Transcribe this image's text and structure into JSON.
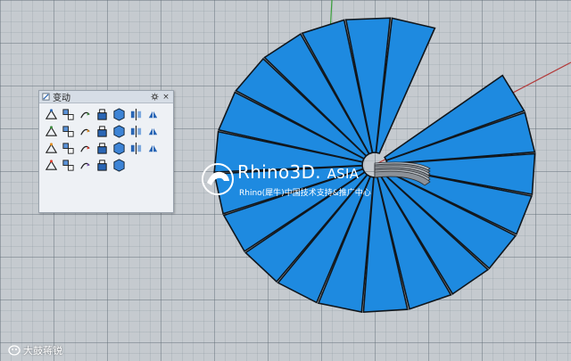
{
  "viewport": {
    "grid_color": "#5f6973",
    "background_color": "#c5cacf",
    "object_color": "#1e8ae0",
    "object_edge_color": "#10161c",
    "x_axis_color": "#b33a3a",
    "y_axis_color": "#3aa03a"
  },
  "toolbar": {
    "title": "变动",
    "settings_icon": "gear-icon",
    "close_symbol": "×",
    "tools": [
      {
        "name": "move-icon"
      },
      {
        "name": "copy-icon"
      },
      {
        "name": "rotate-icon"
      },
      {
        "name": "scale-icon"
      },
      {
        "name": "box-icon"
      },
      {
        "name": "mirror-icon"
      },
      {
        "name": "orient-icon"
      },
      {
        "name": "array-icon"
      },
      {
        "name": "twist-icon"
      },
      {
        "name": "align-icon"
      },
      {
        "name": "flow-icon"
      },
      {
        "name": "bend-icon"
      },
      {
        "name": "grid-array-icon"
      },
      {
        "name": "polar-array-icon"
      },
      {
        "name": "taper-icon"
      },
      {
        "name": "cage-icon"
      },
      {
        "name": "flip-icon"
      },
      {
        "name": "set-point-icon"
      },
      {
        "name": "shear-icon"
      },
      {
        "name": "stretch-icon"
      },
      {
        "name": "smooth-icon"
      },
      {
        "name": "project-icon"
      },
      {
        "name": "splop-icon"
      },
      {
        "name": "sporph-icon"
      },
      {
        "name": "rotate-3d-icon"
      },
      {
        "name": "arrow-right-icon"
      }
    ]
  },
  "watermark": {
    "brand": "Rhino3D.",
    "brand_suffix": "ASIA",
    "caption": "Rhino(犀牛)中国技术支持&推广中心"
  },
  "footer": {
    "text": "大鼓蒋锐"
  }
}
